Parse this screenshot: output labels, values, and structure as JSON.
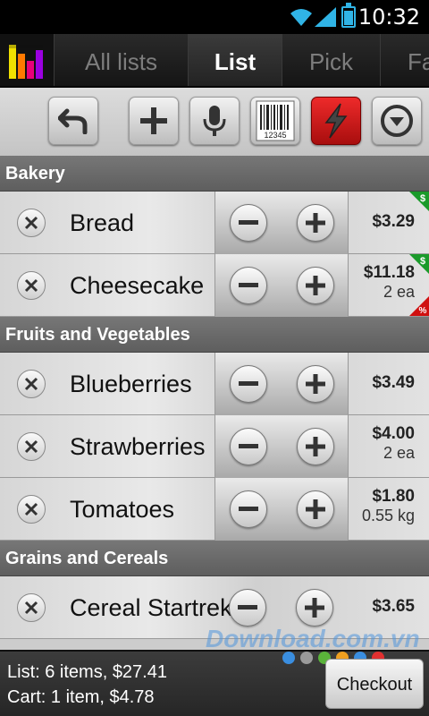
{
  "status_bar": {
    "time": "10:32"
  },
  "tabs": [
    {
      "label": "All lists",
      "active": false
    },
    {
      "label": "List",
      "active": true
    },
    {
      "label": "Pick",
      "active": false
    },
    {
      "label": "Fa",
      "active": false
    }
  ],
  "toolbar": {
    "buttons": [
      "undo-icon",
      "add-icon",
      "microphone-icon",
      "barcode-icon",
      "lightning-icon",
      "dropdown-icon"
    ],
    "barcode_text": "12345",
    "accent_color": "#d61414"
  },
  "sections": [
    {
      "title": "Bakery",
      "items": [
        {
          "name": "Bread",
          "price": "$3.29",
          "qty": ""
        },
        {
          "name": "Cheesecake",
          "price": "$11.18",
          "qty": "2 ea"
        }
      ]
    },
    {
      "title": "Fruits and Vegetables",
      "items": [
        {
          "name": "Blueberries",
          "price": "$3.49",
          "qty": ""
        },
        {
          "name": "Strawberries",
          "price": "$4.00",
          "qty": "2 ea"
        },
        {
          "name": "Tomatoes",
          "price": "$1.80",
          "qty": "0.55 kg"
        }
      ]
    },
    {
      "title": "Grains and Cereals",
      "items": [
        {
          "name": "Cereal Startrek",
          "price": "$3.65",
          "qty": ""
        }
      ]
    }
  ],
  "footer": {
    "list_summary": "List: 6 items, $27.41",
    "cart_summary": "Cart: 1 item, $4.78",
    "checkout_label": "Checkout"
  },
  "watermark": "Download.com.vn"
}
